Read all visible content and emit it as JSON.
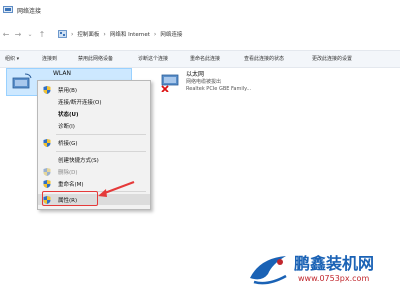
{
  "window": {
    "title": "网络连接"
  },
  "address_bar": {
    "breadcrumbs": [
      "控制面板",
      "网络和 Internet",
      "网络连接"
    ]
  },
  "toolbar": {
    "items": [
      "组织 ▾",
      "连接到",
      "禁用此网络设备",
      "诊断这个连接",
      "重命名此连接",
      "查看此连接的状态",
      "更改此连接的设置"
    ]
  },
  "adapters": [
    {
      "name": "WLAN",
      "lines": []
    },
    {
      "name": "以太网",
      "lines": [
        "网络电缆被拔出",
        "Realtek PCIe GBE Family..."
      ]
    }
  ],
  "context_menu": {
    "items": [
      {
        "label": "禁用(B)",
        "icon": "shield-icon"
      },
      {
        "label": "连接/断开连接(O)"
      },
      {
        "label": "状态(U)",
        "bold": true
      },
      {
        "label": "诊断(I)"
      },
      {
        "label": "桥接(G)",
        "icon": "shield-icon"
      },
      {
        "label": "创建快捷方式(S)"
      },
      {
        "label": "删除(D)",
        "icon": "shield-icon",
        "disabled": true
      },
      {
        "label": "重命名(M)",
        "icon": "shield-icon"
      },
      {
        "label": "属性(R)",
        "icon": "shield-icon",
        "selected": true
      }
    ]
  },
  "watermark": {
    "name": "鹏鑫装机网",
    "url": "www.0753px.com"
  },
  "colors": {
    "highlight": "#e53a3a",
    "toolbar_bg": "#f3f6fa",
    "menu_bg": "#f2f2f2",
    "brand": "#1a62b5"
  }
}
